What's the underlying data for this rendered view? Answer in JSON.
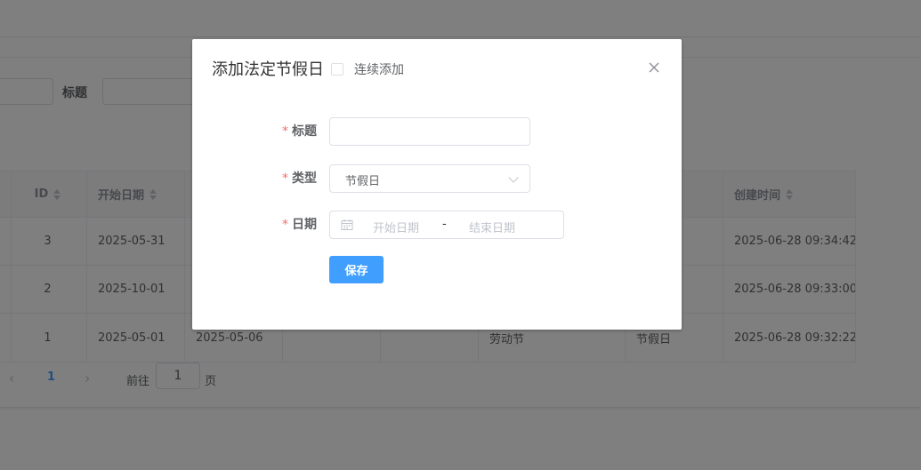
{
  "filters": {
    "title_label": "标题"
  },
  "table": {
    "headers": {
      "id": "ID",
      "start_date": "开始日期",
      "created_at": "创建时间"
    },
    "rows": [
      {
        "id": "3",
        "start_date": "2025-05-31",
        "end_date": "",
        "name": "",
        "type": "",
        "created_at": "2025-06-28 09:34:42"
      },
      {
        "id": "2",
        "start_date": "2025-10-01",
        "end_date": "",
        "name": "",
        "type": "",
        "created_at": "2025-06-28 09:33:00"
      },
      {
        "id": "1",
        "start_date": "2025-05-01",
        "end_date": "2025-05-06",
        "name": "劳动节",
        "type": "节假日",
        "created_at": "2025-06-28 09:32:22"
      }
    ]
  },
  "pagination": {
    "current_page": "1",
    "goto_prefix": "前往",
    "goto_value": "1",
    "goto_suffix": "页"
  },
  "dialog": {
    "title": "添加法定节假日",
    "continuous_label": "连续添加",
    "continuous_checked": false,
    "form": {
      "title_label": "标题",
      "title_value": "",
      "type_label": "类型",
      "type_value": "节假日",
      "date_label": "日期",
      "start_placeholder": "开始日期",
      "range_separator": "-",
      "end_placeholder": "结束日期",
      "required_mark": "*"
    },
    "save_label": "保存"
  },
  "colors": {
    "primary": "#409eff",
    "required": "#f56c6c",
    "overlay": "rgba(0,0,0,0.5)"
  }
}
